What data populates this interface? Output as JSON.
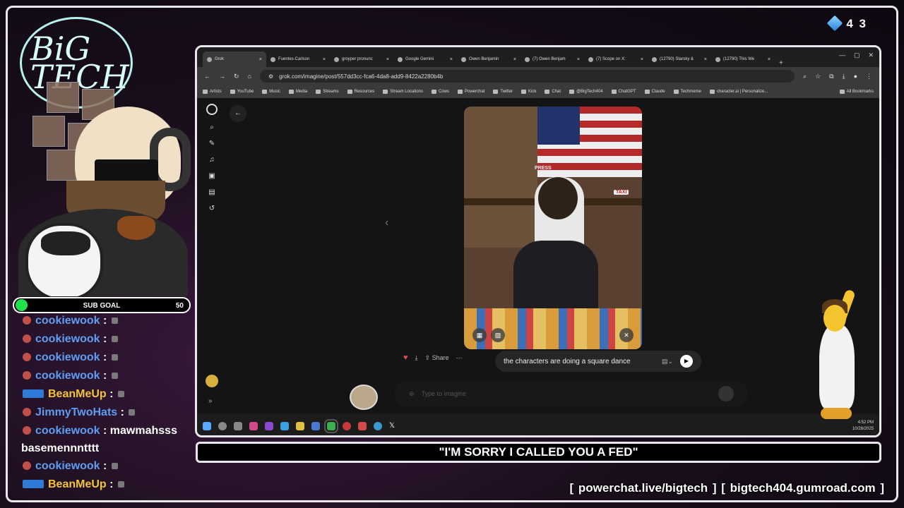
{
  "overlay": {
    "viewer_count": "4 3",
    "sub_goal": {
      "label": "SUB GOAL",
      "target": "50"
    },
    "caption": "\"I'M SORRY I CALLED YOU A FED\"",
    "links": "[ powerchat.live/bigtech ] [ bigtech404.gumroad.com ]",
    "logo_text": "BIG TECH",
    "colors": {
      "accent_green": "#22e04a",
      "frame": "#e9e6ee",
      "username_blue": "#5f9df2",
      "username_gold": "#f3c33a"
    }
  },
  "chat": [
    {
      "user": "cookiewook",
      "text": ""
    },
    {
      "user": "cookiewook",
      "text": ""
    },
    {
      "user": "cookiewook",
      "text": ""
    },
    {
      "user": "cookiewook",
      "text": ""
    },
    {
      "user": "BeanMeUp",
      "text": "",
      "gold": true
    },
    {
      "user": "JimmyTwoHats",
      "text": ""
    },
    {
      "user": "cookiewook",
      "text": "mawmahsss basemennntttt"
    },
    {
      "user": "cookiewook",
      "text": ""
    },
    {
      "user": "BeanMeUp",
      "text": "",
      "gold": true
    }
  ],
  "browser": {
    "tabs": [
      {
        "label": "Grok",
        "active": true
      },
      {
        "label": "Fuentes-Carlson"
      },
      {
        "label": "groyper pronunc"
      },
      {
        "label": "Google Gemini"
      },
      {
        "label": "Owen Benjamin"
      },
      {
        "label": "(7) Owen Benjam"
      },
      {
        "label": "(7) Scope on X:"
      },
      {
        "label": "(12790) Starsky &"
      },
      {
        "label": "(12790) This We"
      }
    ],
    "url": "grok.com/imagine/post/557dd3cc-fca6-4da8-add9-8422a2280b4b",
    "bookmarks": [
      "Artists",
      "YouTube",
      "Music",
      "Media",
      "Streams",
      "Resources",
      "Stream Locations",
      "Cows",
      "Powerchat",
      "Twitter",
      "Kick",
      "Chat",
      "@BigTech404",
      "ChatGPT",
      "Claude",
      "Techmeme",
      "character.ai | Personalize..."
    ],
    "all_bookmarks": "All Bookmarks",
    "share_label": "Share",
    "prompt_text": "the characters are doing a square dance",
    "imagine_placeholder": "Type to imagine",
    "clock_time": "4:52 PM",
    "clock_date": "10/28/2025",
    "video_labels": {
      "press": "PRESS",
      "taxi": "TAXI"
    }
  }
}
